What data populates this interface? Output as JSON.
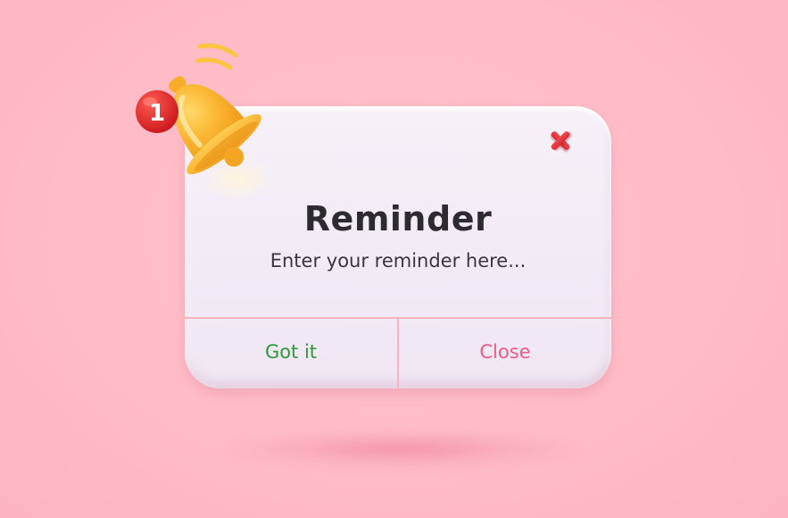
{
  "dialog": {
    "title": "Reminder",
    "message": "Enter your reminder here...",
    "confirm_label": "Got it",
    "close_label": "Close",
    "close_icon": "close-x-icon"
  },
  "bell": {
    "icon": "bell-icon",
    "badge_count": "1"
  },
  "colors": {
    "background": "#ffbcc7",
    "dialog": "#f3ecf7",
    "title": "#2d2a30",
    "confirm": "#2f9a3a",
    "close": "#ef5a86",
    "divider": "#f7b3c0",
    "badge": "#e52a2e",
    "bell": "#fbb733"
  }
}
